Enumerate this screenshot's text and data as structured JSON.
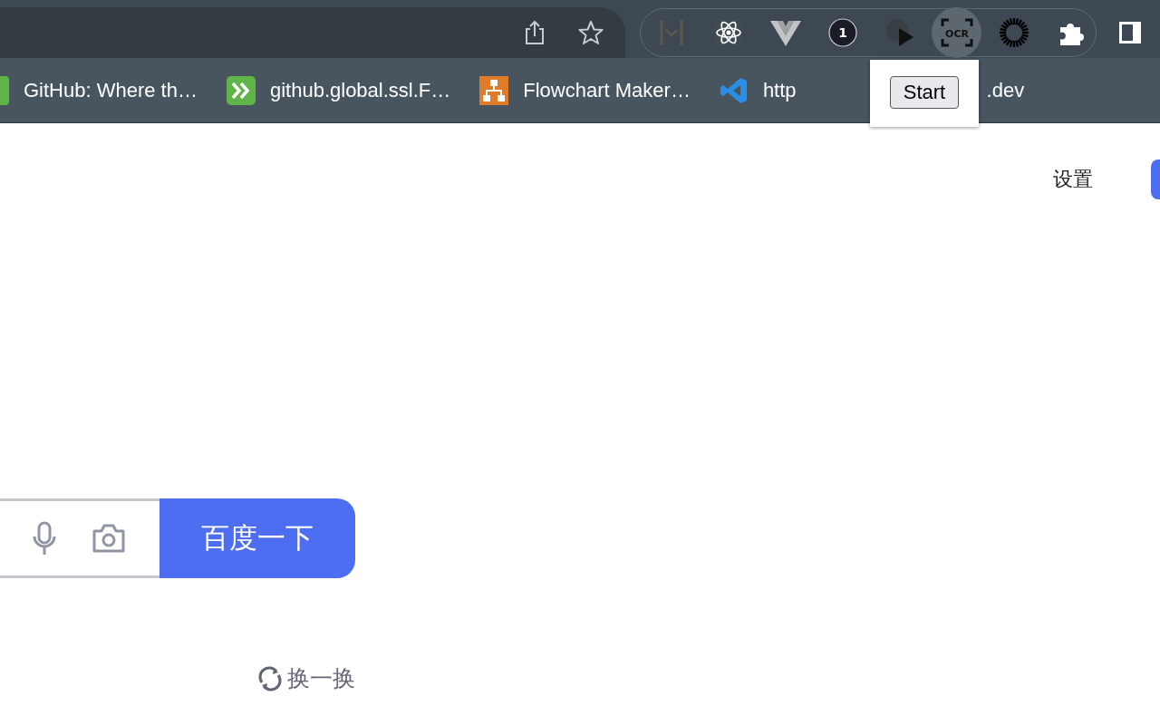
{
  "toolbar": {
    "address_actions": [
      {
        "kind": "share"
      },
      {
        "kind": "star"
      }
    ],
    "extensions": [
      {
        "kind": "bracket",
        "highlighted": false
      },
      {
        "kind": "atom",
        "highlighted": false
      },
      {
        "kind": "vee",
        "highlighted": false
      },
      {
        "kind": "circle-badge",
        "text": "1",
        "highlighted": false
      },
      {
        "kind": "play",
        "highlighted": false
      },
      {
        "kind": "scan",
        "text": "OCR",
        "highlighted": true
      },
      {
        "kind": "sunburst",
        "highlighted": false
      },
      {
        "kind": "puzzle",
        "highlighted": false
      }
    ]
  },
  "bookmarks": [
    {
      "kind": "github",
      "label": "GitHub: Where th…"
    },
    {
      "kind": "chevrons",
      "label": "github.global.ssl.F…"
    },
    {
      "kind": "flowchart",
      "label": "Flowchart Maker…"
    },
    {
      "kind": "code",
      "label": "http",
      "label_end": ".dev"
    }
  ],
  "popup": {
    "button": "Start"
  },
  "page": {
    "settings": "设置",
    "search_button": "百度一下",
    "refresh": "换一换"
  }
}
